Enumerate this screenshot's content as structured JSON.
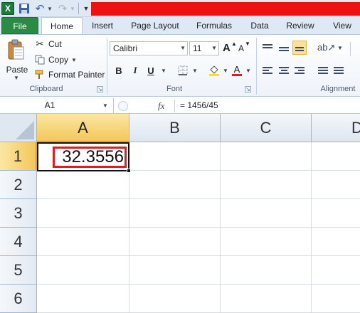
{
  "qat": {
    "app_icon_letter": "X",
    "title_bar_color": "#ee1111"
  },
  "tabs": [
    {
      "label": "File"
    },
    {
      "label": "Home"
    },
    {
      "label": "Insert"
    },
    {
      "label": "Page Layout"
    },
    {
      "label": "Formulas"
    },
    {
      "label": "Data"
    },
    {
      "label": "Review"
    },
    {
      "label": "View"
    }
  ],
  "ribbon": {
    "clipboard": {
      "paste_label": "Paste",
      "cut_label": "Cut",
      "copy_label": "Copy",
      "format_painter_label": "Format Painter",
      "group_label": "Clipboard"
    },
    "font": {
      "font_name": "Calibri",
      "font_size": "11",
      "bold": "B",
      "italic": "I",
      "underline": "U",
      "font_color_letter": "A",
      "grow_letter": "A",
      "shrink_letter": "A",
      "group_label": "Font"
    },
    "alignment": {
      "group_label": "Alignment"
    }
  },
  "formula_bar": {
    "name_box": "A1",
    "fx_label": "fx",
    "formula": "= 1456/45"
  },
  "grid": {
    "columns": [
      "A",
      "B",
      "C",
      "D"
    ],
    "rows": [
      "1",
      "2",
      "3",
      "4",
      "5",
      "6"
    ],
    "selected_cell": "A1",
    "cells": {
      "A1": "32.3556"
    },
    "highlight_color": "#e01b24"
  }
}
